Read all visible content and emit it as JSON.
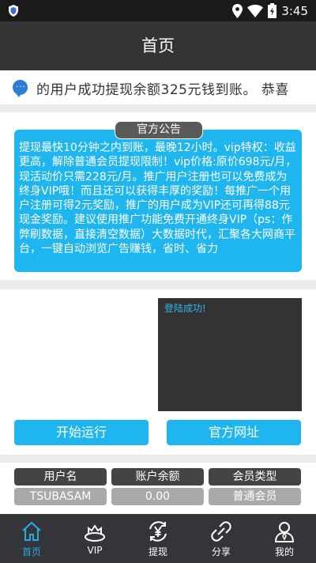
{
  "status_bar": {
    "time": "3:45"
  },
  "app_bar": {
    "title": "首页"
  },
  "marquee": {
    "text": "的用户成功提现余额325元钱到账。        恭喜"
  },
  "notice": {
    "title": "官方公告",
    "body": "提现最快10分钟之内到账，最晚12小时。vip特权：收益更高，解除普通会员提现限制！vip价格:原价698元/月，现活动价只需228元/月。推广用户注册也可以免费成为终身VIP哦！而且还可以获得丰厚的奖励！每推广一个用户注册可得2元奖励，推广的用户成为VIP还可再得88元现金奖励。建议使用推广功能免费开通终身VIP（ps：作弊刷数据，直接清空数据）大数据时代，汇聚各大网商平台，一键自动浏览广告赚钱，省时、省力"
  },
  "log": {
    "text": "登陆成功!"
  },
  "buttons": {
    "start": "开始运行",
    "site": "官方网址"
  },
  "user_table": {
    "headers": [
      "用户名",
      "账户余额",
      "会员类型"
    ],
    "values": [
      "TSUBASAM",
      "0.00",
      "普通会员"
    ]
  },
  "tabs": [
    {
      "label": "首页",
      "icon": "home-icon",
      "active": true
    },
    {
      "label": "VIP",
      "icon": "crown-icon",
      "active": false
    },
    {
      "label": "提现",
      "icon": "withdraw-yen-icon",
      "active": false
    },
    {
      "label": "分享",
      "icon": "link-icon",
      "active": false
    },
    {
      "label": "我的",
      "icon": "user-icon",
      "active": false
    }
  ],
  "colors": {
    "accent": "#1fb6ef",
    "tab_active": "#2aa9e3",
    "dark_bar": "#333436"
  }
}
